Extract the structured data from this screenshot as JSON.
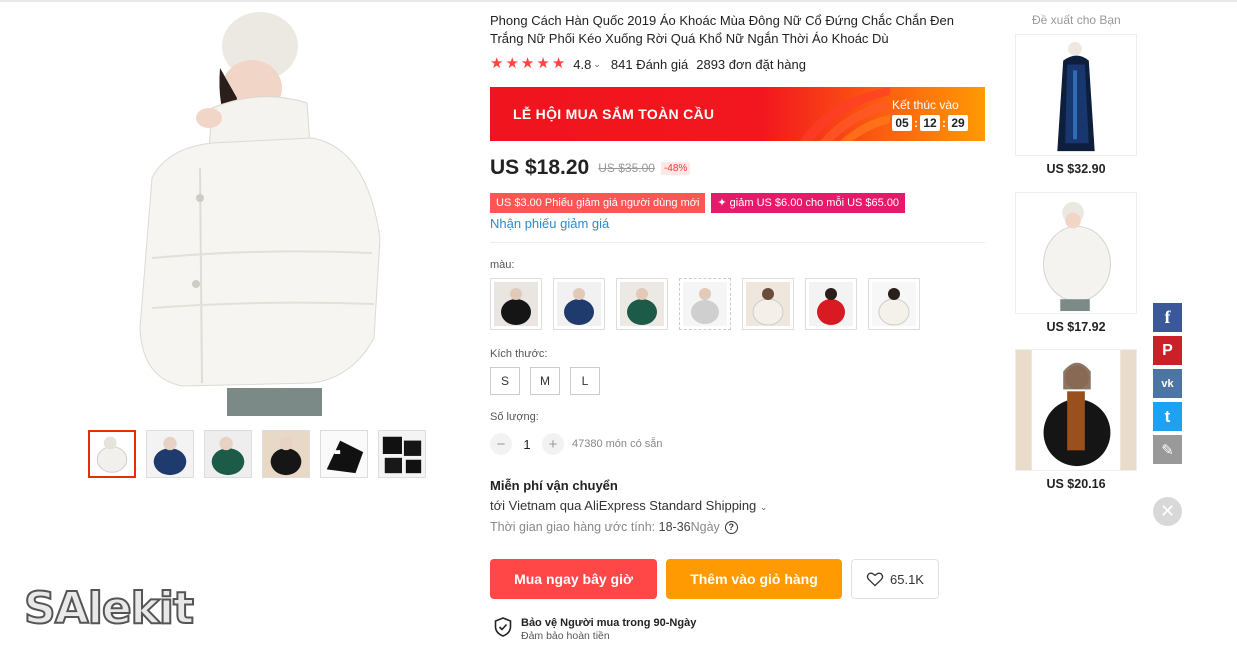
{
  "product": {
    "title": "Phong Cách Hàn Quốc 2019 Áo Khoác Mùa Đông Nữ Cổ Đứng Chắc Chắn Đen Trắng Nữ Phối Kéo Xuống Rời Quá Khổ Nữ Ngắn Thời Áo Khoác Dù",
    "rating": "4.8",
    "reviews": "841 Đánh giá",
    "orders": "2893 đơn đặt hàng"
  },
  "banner": {
    "title": "LỄ HỘI MUA SẮM TOÀN CẦU",
    "ends_label": "Kết thúc vào",
    "hours": "05",
    "minutes": "12",
    "seconds": "29",
    "colors": {
      "start": "#f0141e",
      "end": "#ff9a04"
    }
  },
  "price": {
    "current": "US $18.20",
    "original": "US $35.00",
    "discount": "-48%"
  },
  "coupons": [
    "US $3.00 Phiếu giảm giá người dùng mới",
    "✦ giảm US $6.00 cho mỗi US $65.00"
  ],
  "coupon_link": "Nhận phiếu giảm giá",
  "color_label": "màu:",
  "color_options": [
    "black",
    "navy",
    "green",
    "grey",
    "white-beige",
    "red",
    "cream"
  ],
  "size_label": "Kích thước:",
  "sizes": [
    "S",
    "M",
    "L"
  ],
  "quantity": {
    "label": "Số lượng:",
    "value": "1",
    "minus": "−",
    "plus": "+",
    "stock": "47380 món có sẵn"
  },
  "shipping": {
    "title": "Miễn phí vận chuyển",
    "to": "tới Vietnam qua AliExpress Standard Shipping",
    "time_label": "Thời gian giao hàng ước tính:",
    "time_value": "18-36",
    "time_unit": "Ngày"
  },
  "actions": {
    "buy_now": "Mua ngay bây giờ",
    "add_to_cart": "Thêm vào giỏ hàng",
    "wishlist_count": "65.1K"
  },
  "protection": {
    "title": "Bảo vệ Người mua trong 90-Ngày",
    "subtitle": "Đảm bảo hoàn tiền"
  },
  "recommendations": {
    "title": "Đề xuất cho Bạn",
    "items": [
      {
        "price": "US $32.90"
      },
      {
        "price": "US $17.92"
      },
      {
        "price": "US $20.16"
      }
    ]
  },
  "share": [
    {
      "icon": "facebook-icon",
      "glyph": "f",
      "color": "#3b5998"
    },
    {
      "icon": "pinterest-icon",
      "glyph": "P",
      "color": "#cb2027"
    },
    {
      "icon": "vk-icon",
      "glyph": "vk",
      "color": "#4c75a3"
    },
    {
      "icon": "twitter-icon",
      "glyph": "t",
      "color": "#1da1f2"
    },
    {
      "icon": "edit-icon",
      "glyph": "✎",
      "color": "#999999"
    }
  ],
  "watermark": "SAlekit",
  "accent": "#ff4747"
}
